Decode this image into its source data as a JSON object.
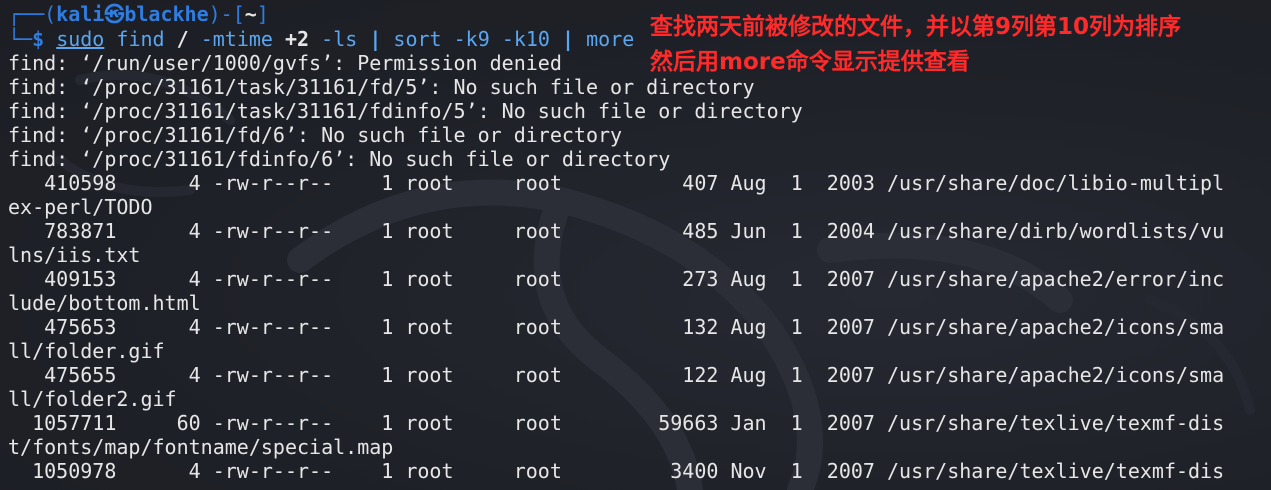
{
  "prompt": {
    "top_prefix": "┌──(",
    "user": "kali㉿blackhe",
    "mid": ")-[",
    "dir": "~",
    "end": "]",
    "bottom_prefix": "└─",
    "dollar": "$"
  },
  "command": {
    "sudo": "sudo",
    "find": "find",
    "root_arg": "/",
    "mtime_opt": "-mtime",
    "mtime_val": "+2",
    "ls_opt": "-ls",
    "pipe1": "|",
    "sort": "sort",
    "k9": "-k9",
    "k10": "-k10",
    "pipe2": "|",
    "more": "more"
  },
  "annotation": {
    "line1": "查找两天前被修改的文件，并以第9列第10列为排序",
    "line2": "然后用more命令显示提供查看"
  },
  "output_lines": [
    "find: ‘/run/user/1000/gvfs’: Permission denied",
    "find: ‘/proc/31161/task/31161/fd/5’: No such file or directory",
    "find: ‘/proc/31161/task/31161/fdinfo/5’: No such file or directory",
    "find: ‘/proc/31161/fd/6’: No such file or directory",
    "find: ‘/proc/31161/fdinfo/6’: No such file or directory",
    "   410598      4 -rw-r--r--    1 root     root          407 Aug  1  2003 /usr/share/doc/libio-multipl",
    "ex-perl/TODO",
    "   783871      4 -rw-r--r--    1 root     root          485 Jun  1  2004 /usr/share/dirb/wordlists/vu",
    "lns/iis.txt",
    "   409153      4 -rw-r--r--    1 root     root          273 Aug  1  2007 /usr/share/apache2/error/inc",
    "lude/bottom.html",
    "   475653      4 -rw-r--r--    1 root     root          132 Aug  1  2007 /usr/share/apache2/icons/sma",
    "ll/folder.gif",
    "   475655      4 -rw-r--r--    1 root     root          122 Aug  1  2007 /usr/share/apache2/icons/sma",
    "ll/folder2.gif",
    "  1057711     60 -rw-r--r--    1 root     root        59663 Jan  1  2007 /usr/share/texlive/texmf-dis",
    "t/fonts/map/fontname/special.map",
    "  1050978      4 -rw-r--r--    1 root     root         3400 Nov  1  2007 /usr/share/texlive/texmf-dis"
  ],
  "colors": {
    "background": "#1e2027",
    "prompt": "#2f7de1",
    "command": "#5aa6f0",
    "text": "#e6e6e6",
    "annotation": "#ff2b2b"
  }
}
